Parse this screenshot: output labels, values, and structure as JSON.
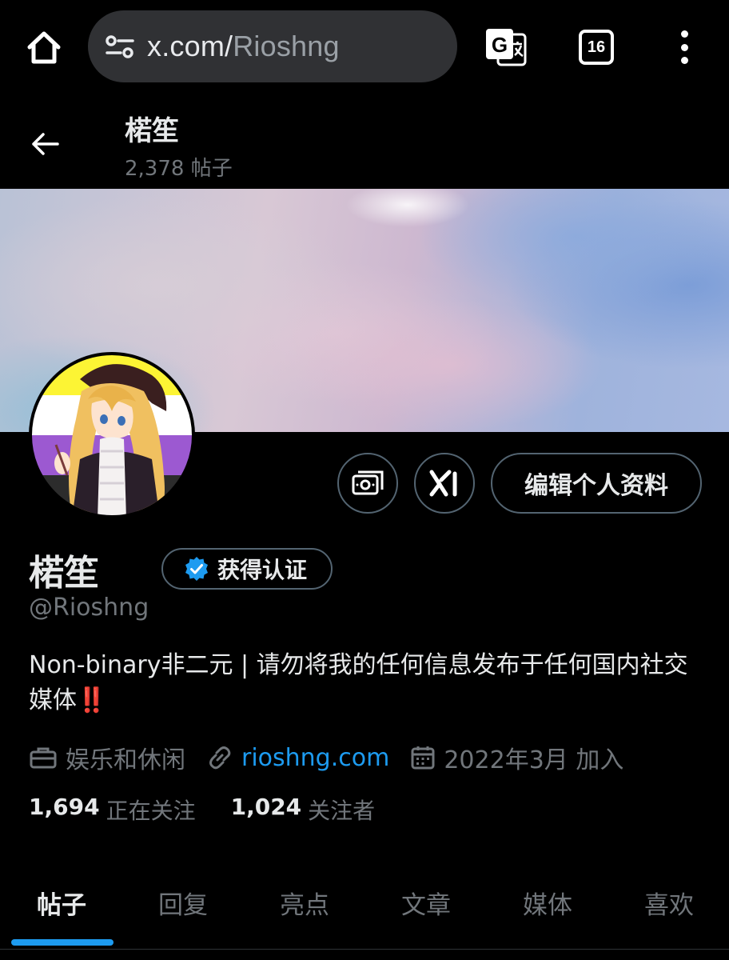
{
  "browser": {
    "url_host": "x.com/",
    "url_path": "Rioshng",
    "tab_count": "16"
  },
  "header": {
    "name": "楉笙",
    "post_count": "2,378 帖子"
  },
  "actions": {
    "edit_profile": "编辑个人资料"
  },
  "profile": {
    "name": "楉笙",
    "verify_label": "获得认证",
    "handle": "@Rioshng",
    "bio_text": "Non-binary非二元 | 请勿将我的任何信息发布于任何国内社交媒体",
    "bio_emoji": "‼️",
    "category": "娱乐和休闲",
    "website": "rioshng.com",
    "joined": "2022年3月 加入",
    "following_count": "1,694",
    "following_label": "正在关注",
    "followers_count": "1,024",
    "followers_label": "关注者"
  },
  "tabs": [
    {
      "label": "帖子",
      "active": true
    },
    {
      "label": "回复",
      "active": false
    },
    {
      "label": "亮点",
      "active": false
    },
    {
      "label": "文章",
      "active": false
    },
    {
      "label": "媒体",
      "active": false
    },
    {
      "label": "喜欢",
      "active": false
    }
  ],
  "colors": {
    "background": "#000000",
    "text_primary": "#e7e9ea",
    "text_secondary": "#71767b",
    "accent": "#1d9bf0",
    "border": "#536471",
    "url_pill": "#303134"
  },
  "icons": {
    "home": "home-icon",
    "site_settings": "tune-icon",
    "translate": "translate-icon",
    "menu": "more-vert-icon",
    "back": "arrow-left-icon",
    "tip": "money-icon",
    "grok": "grok-icon",
    "verified": "verified-badge-icon",
    "category": "briefcase-icon",
    "link": "link-icon",
    "calendar": "calendar-icon"
  }
}
